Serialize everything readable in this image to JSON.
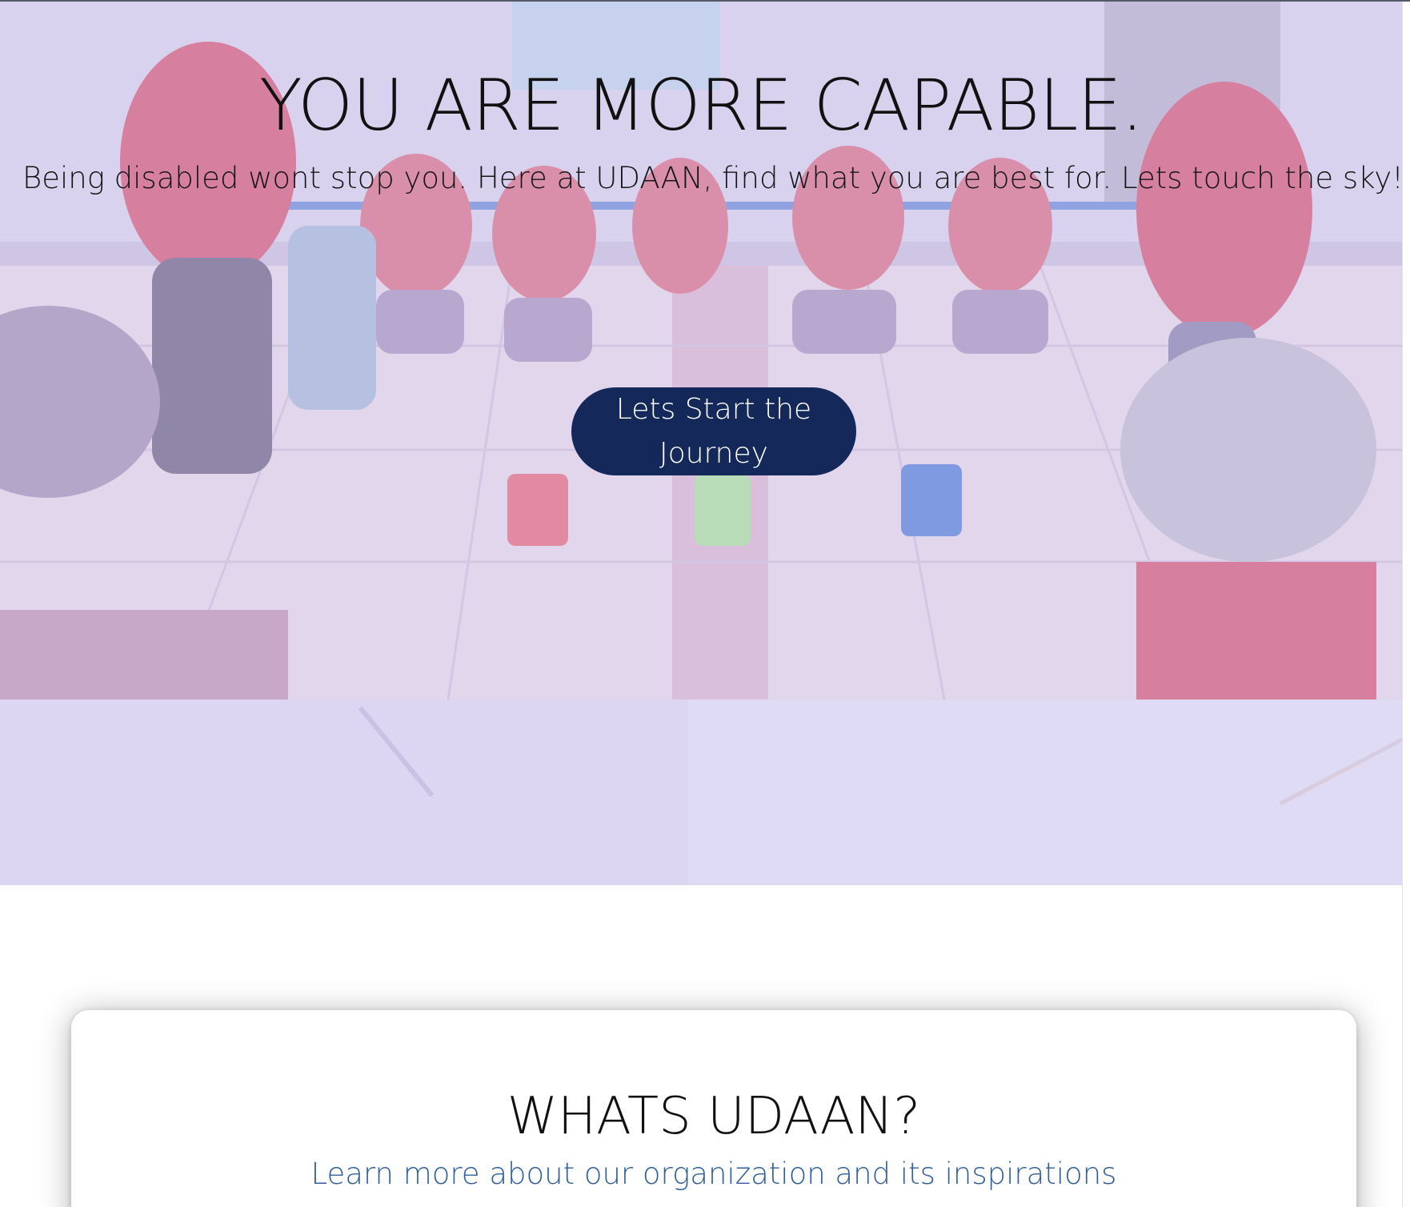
{
  "hero": {
    "title": "YOU ARE MORE CAPABLE.",
    "subtitle": "Being disabled wont stop you. Here at UDAAN, find what you are best for. Lets touch the sky!",
    "cta_label": "Lets Start the Journey",
    "overlay_color": "#d8d0ee",
    "button_color": "#14285a"
  },
  "about": {
    "title": "WHATS UDAAN?",
    "subtitle": "Learn more about our organization and its inspirations",
    "subtitle_color": "#2f5f9e"
  }
}
